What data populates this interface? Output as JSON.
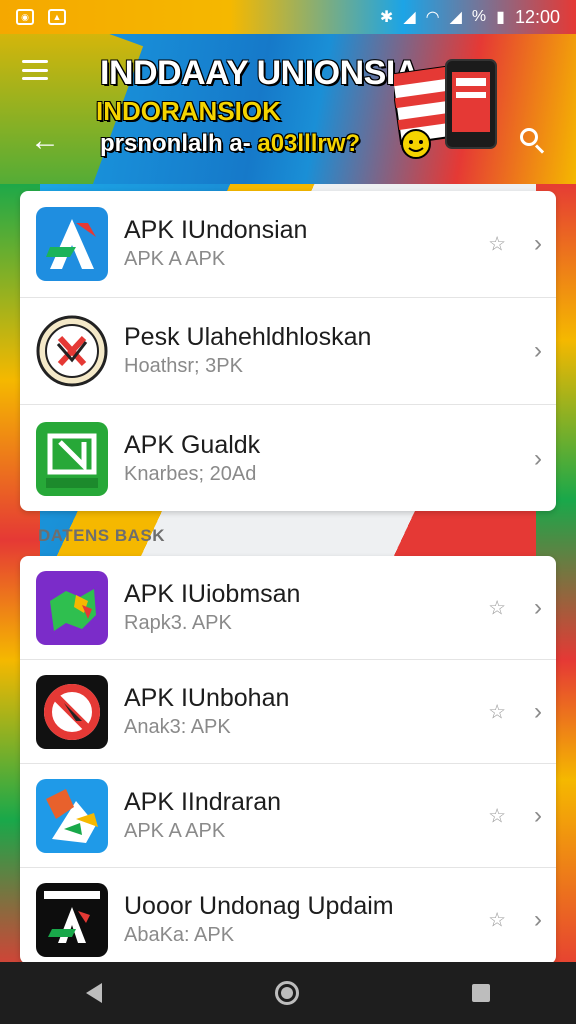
{
  "status": {
    "time": "12:00",
    "battery": "%"
  },
  "header": {
    "title_line1": "INDDAAY UNIONSIA",
    "title_line2": "INDORANSIOK",
    "title_line3_a": "prsnonlalh a- ",
    "title_line3_b": "a03lllrw?"
  },
  "list_top": [
    {
      "name": "APK IUndonsian",
      "sub": "APK A APK",
      "icon": "apk-a-icon",
      "starred": true
    },
    {
      "name": "Pesk Ulahehldhloskan",
      "sub": "Hoathsr; 3PK",
      "icon": "seal-icon",
      "starred": false
    },
    {
      "name": "APK Gualdk",
      "sub": "Knarbes; 20Ad",
      "icon": "green-n-icon",
      "starred": false
    }
  ],
  "section": {
    "label": "DATENS BASK"
  },
  "list_bottom": [
    {
      "name": "APK IUiobmsan",
      "sub": "Rapk3. APK",
      "icon": "map-icon",
      "starred": true
    },
    {
      "name": "APK IUnbohan",
      "sub": "Anak3: APK",
      "icon": "no-sign-icon",
      "starred": true
    },
    {
      "name": "APK IIndraran",
      "sub": "APK A APK",
      "icon": "paint-icon",
      "starred": true
    },
    {
      "name": "Uooor Undonag Updaim",
      "sub": "AbaKa: APK",
      "icon": "black-a-icon",
      "starred": true
    }
  ],
  "icons": {
    "star": "☆",
    "chevron": "›",
    "back": "←"
  },
  "colors": {
    "red": "#e53935",
    "yellow": "#f5b800",
    "green": "#19a84a",
    "blue": "#1a8fd6"
  }
}
